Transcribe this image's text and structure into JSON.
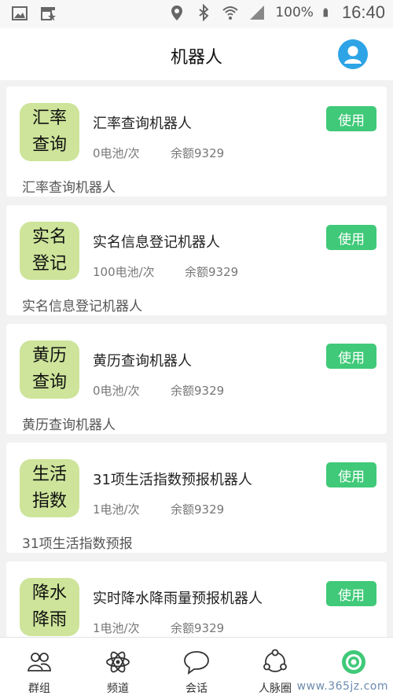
{
  "status_bar": {
    "battery": "100%",
    "time": "16:40"
  },
  "header": {
    "title": "机器人"
  },
  "robots": [
    {
      "badge_line1": "汇率",
      "badge_line2": "查询",
      "name": "汇率查询机器人",
      "cost": "0电池/次",
      "balance": "余额9329",
      "description": "汇率查询机器人",
      "button": "使用"
    },
    {
      "badge_line1": "实名",
      "badge_line2": "登记",
      "name": "实名信息登记机器人",
      "cost": "100电池/次",
      "balance": "余额9329",
      "description": "实名信息登记机器人",
      "button": "使用"
    },
    {
      "badge_line1": "黄历",
      "badge_line2": "查询",
      "name": "黄历查询机器人",
      "cost": "0电池/次",
      "balance": "余额9329",
      "description": "黄历查询机器人",
      "button": "使用"
    },
    {
      "badge_line1": "生活",
      "badge_line2": "指数",
      "name": "31项生活指数预报机器人",
      "cost": "1电池/次",
      "balance": "余额9329",
      "description": "31项生活指数预报",
      "button": "使用"
    },
    {
      "badge_line1": "降水",
      "badge_line2": "降雨",
      "name": "实时降水降雨量预报机器人",
      "cost": "1电池/次",
      "balance": "余额9329",
      "description": "",
      "button": "使用"
    }
  ],
  "tabbar": {
    "items": [
      {
        "label": "群组",
        "icon": "group-icon"
      },
      {
        "label": "频道",
        "icon": "atom-icon"
      },
      {
        "label": "会话",
        "icon": "chat-bubble-icon"
      },
      {
        "label": "人脉圈",
        "icon": "network-icon"
      },
      {
        "label": "",
        "icon": "target-icon",
        "active": true
      }
    ]
  },
  "watermark": "www.365jz.com",
  "colors": {
    "accent_green": "#3fc978",
    "badge_green": "#cde49a",
    "avatar_blue": "#2ea4e6"
  }
}
